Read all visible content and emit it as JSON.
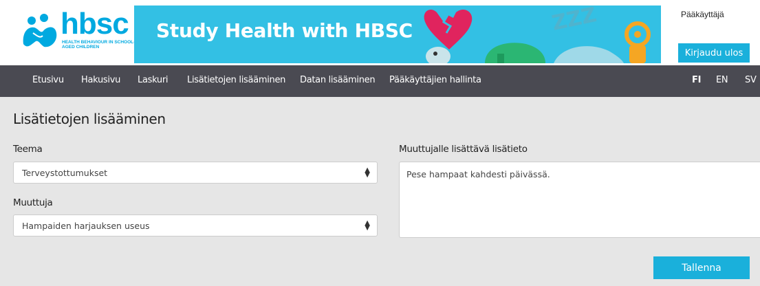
{
  "header": {
    "logo_text": "hbsc",
    "logo_subtext": "HEALTH BEHAVIOUR IN SCHOOL-AGED CHILDREN",
    "banner_title": "Study Health with HBSC",
    "user_role": "Pääkäyttäjä",
    "logout_label": "Kirjaudu ulos"
  },
  "nav": {
    "items": [
      {
        "label": "Etusivu"
      },
      {
        "label": "Hakusivu"
      },
      {
        "label": "Laskuri"
      },
      {
        "label": "Lisätietojen lisääminen"
      },
      {
        "label": "Datan lisääminen"
      },
      {
        "label": "Pääkäyttäjien hallinta"
      }
    ],
    "languages": [
      {
        "label": "FI",
        "active": true
      },
      {
        "label": "EN",
        "active": false
      },
      {
        "label": "SV",
        "active": false
      }
    ]
  },
  "main": {
    "title": "Lisätietojen lisääminen",
    "theme_label": "Teema",
    "theme_value": "Terveystottumukset",
    "variable_label": "Muuttuja",
    "variable_value": "Hampaiden harjauksen useus",
    "info_label": "Muuttujalle lisättävä lisätieto",
    "info_value": "Pese hampaat kahdesti päivässä.",
    "save_label": "Tallenna"
  },
  "colors": {
    "accent": "#1ab0db",
    "banner": "#33c0e4",
    "nav_bg": "#4a4a52",
    "content_bg": "#e6e6e6"
  }
}
